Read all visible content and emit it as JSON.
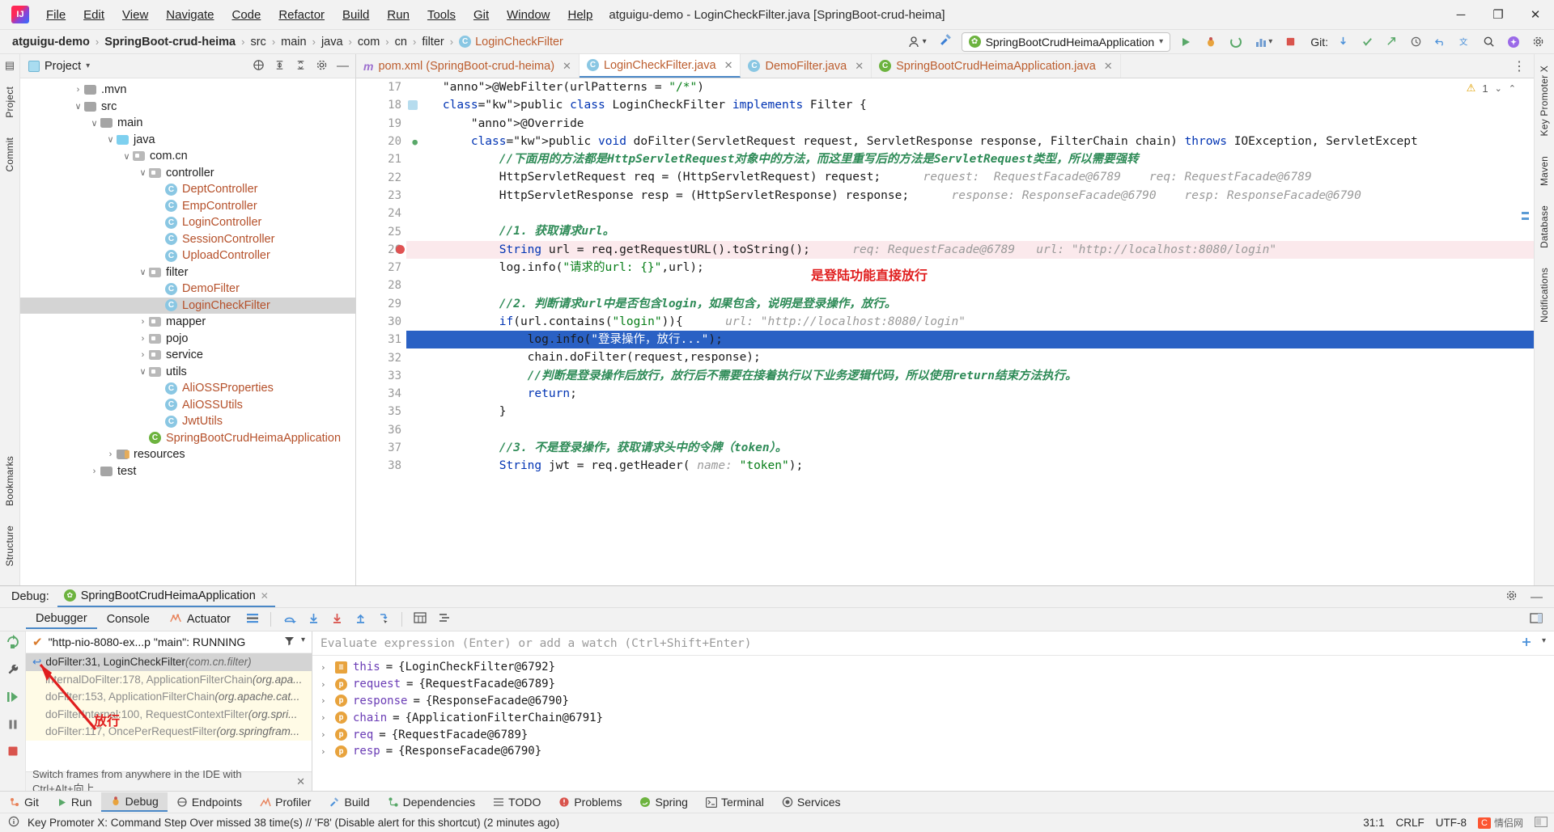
{
  "window": {
    "title": "atguigu-demo - LoginCheckFilter.java [SpringBoot-crud-heima]",
    "minimize": "─",
    "maximize": "❐",
    "close": "✕",
    "logo_text": "IJ"
  },
  "menu": [
    {
      "label": "File"
    },
    {
      "label": "Edit"
    },
    {
      "label": "View"
    },
    {
      "label": "Navigate"
    },
    {
      "label": "Code"
    },
    {
      "label": "Refactor"
    },
    {
      "label": "Build"
    },
    {
      "label": "Run"
    },
    {
      "label": "Tools"
    },
    {
      "label": "Git"
    },
    {
      "label": "Window"
    },
    {
      "label": "Help"
    }
  ],
  "breadcrumb": {
    "items": [
      {
        "label": "atguigu-demo",
        "bold": true
      },
      {
        "label": "SpringBoot-crud-heima",
        "bold": true
      },
      {
        "label": "src",
        "bold": false
      },
      {
        "label": "main",
        "bold": false
      },
      {
        "label": "java",
        "bold": false
      },
      {
        "label": "com",
        "bold": false
      },
      {
        "label": "cn",
        "bold": false
      },
      {
        "label": "filter",
        "bold": false
      },
      {
        "label": "LoginCheckFilter",
        "bold": false,
        "class_icon": "C",
        "is_file": true
      }
    ],
    "separator": "›",
    "run_config": "SpringBootCrudHeimaApplication",
    "run_config_caret": "▾",
    "git_label": "Git:"
  },
  "project_panel": {
    "title": "Project",
    "caret": "▾",
    "tree": [
      {
        "depth": 3,
        "twisty": "›",
        "icon": "folder",
        "label": ".mvn",
        "type": "dir"
      },
      {
        "depth": 3,
        "twisty": "∨",
        "icon": "folder",
        "label": "src",
        "type": "dir"
      },
      {
        "depth": 4,
        "twisty": "∨",
        "icon": "folder",
        "label": "main",
        "type": "dir"
      },
      {
        "depth": 5,
        "twisty": "∨",
        "icon": "folder-blue",
        "label": "java",
        "type": "dir"
      },
      {
        "depth": 6,
        "twisty": "∨",
        "icon": "folder-pkg",
        "label": "com.cn",
        "type": "dir"
      },
      {
        "depth": 7,
        "twisty": "∨",
        "icon": "folder-pkg",
        "label": "controller",
        "type": "dir"
      },
      {
        "depth": 8,
        "twisty": "",
        "icon": "class",
        "label": "DeptController",
        "type": "class"
      },
      {
        "depth": 8,
        "twisty": "",
        "icon": "class",
        "label": "EmpController",
        "type": "class"
      },
      {
        "depth": 8,
        "twisty": "",
        "icon": "class",
        "label": "LoginController",
        "type": "class"
      },
      {
        "depth": 8,
        "twisty": "",
        "icon": "class",
        "label": "SessionController",
        "type": "class"
      },
      {
        "depth": 8,
        "twisty": "",
        "icon": "class",
        "label": "UploadController",
        "type": "class"
      },
      {
        "depth": 7,
        "twisty": "∨",
        "icon": "folder-pkg",
        "label": "filter",
        "type": "dir"
      },
      {
        "depth": 8,
        "twisty": "",
        "icon": "class",
        "label": "DemoFilter",
        "type": "class"
      },
      {
        "depth": 8,
        "twisty": "",
        "icon": "class",
        "label": "LoginCheckFilter",
        "type": "class",
        "selected": true
      },
      {
        "depth": 7,
        "twisty": "›",
        "icon": "folder-pkg",
        "label": "mapper",
        "type": "dir"
      },
      {
        "depth": 7,
        "twisty": "›",
        "icon": "folder-pkg",
        "label": "pojo",
        "type": "dir"
      },
      {
        "depth": 7,
        "twisty": "›",
        "icon": "folder-pkg",
        "label": "service",
        "type": "dir"
      },
      {
        "depth": 7,
        "twisty": "∨",
        "icon": "folder-pkg",
        "label": "utils",
        "type": "dir"
      },
      {
        "depth": 8,
        "twisty": "",
        "icon": "class",
        "label": "AliOSSProperties",
        "type": "class"
      },
      {
        "depth": 8,
        "twisty": "",
        "icon": "class",
        "label": "AliOSSUtils",
        "type": "class"
      },
      {
        "depth": 8,
        "twisty": "",
        "icon": "class",
        "label": "JwtUtils",
        "type": "class"
      },
      {
        "depth": 7,
        "twisty": "",
        "icon": "spring",
        "label": "SpringBootCrudHeimaApplication",
        "type": "class"
      },
      {
        "depth": 5,
        "twisty": "›",
        "icon": "folder-res",
        "label": "resources",
        "type": "dir"
      },
      {
        "depth": 4,
        "twisty": "›",
        "icon": "folder",
        "label": "test",
        "type": "dir"
      }
    ]
  },
  "editor": {
    "tabs": [
      {
        "label": "pom.xml (SpringBoot-crud-heima)",
        "icon": "maven",
        "active": false
      },
      {
        "label": "LoginCheckFilter.java",
        "icon": "class",
        "active": true
      },
      {
        "label": "DemoFilter.java",
        "icon": "class",
        "active": false
      },
      {
        "label": "SpringBootCrudHeimaApplication.java",
        "icon": "spring",
        "active": false
      }
    ],
    "tab_close": "✕",
    "more": "⋮",
    "warning_count": "1",
    "warning_icon": "⚠",
    "first_line_number": 17,
    "lines": [
      {
        "n": 17,
        "fold": "−",
        "text": "    @WebFilter(urlPatterns = \"/*\")"
      },
      {
        "n": 18,
        "text": "    public class LoginCheckFilter implements Filter {"
      },
      {
        "n": 19,
        "text": "        @Override"
      },
      {
        "n": 20,
        "fold": "−",
        "text": "        public void doFilter(ServletRequest request, ServletResponse response, FilterChain chain) throws IOException, ServletExcept"
      },
      {
        "n": 21,
        "text": "            //下面用的方法都是HttpServletRequest对象中的方法，而这里重写后的方法是ServletRequest类型，所以需要强转"
      },
      {
        "n": 22,
        "text": "            HttpServletRequest req = (HttpServletRequest) request;",
        "hint": "request:  RequestFacade@6789    req: RequestFacade@6789"
      },
      {
        "n": 23,
        "text": "            HttpServletResponse resp = (HttpServletResponse) response;",
        "hint": "response: ResponseFacade@6790    resp: ResponseFacade@6790"
      },
      {
        "n": 24,
        "text": ""
      },
      {
        "n": 25,
        "text": "            //1. 获取请求url。"
      },
      {
        "n": 26,
        "text": "            String url = req.getRequestURL().toString();",
        "hint": "req: RequestFacade@6789   url: \"http://localhost:8080/login\"",
        "breakpoint": true
      },
      {
        "n": 27,
        "text": "            log.info(\"请求的url: {}\",url);"
      },
      {
        "n": 28,
        "text": ""
      },
      {
        "n": 29,
        "text": "            //2. 判断请求url中是否包含login，如果包含，说明是登录操作，放行。"
      },
      {
        "n": 30,
        "fold": "−",
        "text": "            if(url.contains(\"login\")){",
        "hint": "url: \"http://localhost:8080/login\""
      },
      {
        "n": 31,
        "text": "                log.info(\"登录操作，放行...\");",
        "highlight": true
      },
      {
        "n": 32,
        "text": "                chain.doFilter(request,response);"
      },
      {
        "n": 33,
        "text": "                //判断是登录操作后放行，放行后不需要在接着执行以下业务逻辑代码，所以使用return结束方法执行。"
      },
      {
        "n": 34,
        "text": "                return;"
      },
      {
        "n": 35,
        "fold": "−",
        "text": "            }"
      },
      {
        "n": 36,
        "text": ""
      },
      {
        "n": 37,
        "text": "            //3. 不是登录操作，获取请求头中的令牌（token）。"
      },
      {
        "n": 38,
        "text": "            String jwt = req.getHeader( name: \"token\");"
      }
    ],
    "annotation_red": "是登陆功能直接放行"
  },
  "debug": {
    "header_label": "Debug:",
    "session_tab": "SpringBootCrudHeimaApplication",
    "session_close": "✕",
    "tabs": [
      {
        "label": "Debugger",
        "active": true
      },
      {
        "label": "Console",
        "active": false
      },
      {
        "label": "Actuator",
        "active": false
      }
    ],
    "thread": "\"http-nio-8080-ex...p \"main\": RUNNING",
    "frames": [
      {
        "label": "doFilter:31, LoginCheckFilter",
        "detail": "(com.cn.filter)",
        "selected": true
      },
      {
        "label": "internalDoFilter:178, ApplicationFilterChain",
        "detail": "(org.apa...",
        "lib": true
      },
      {
        "label": "doFilter:153, ApplicationFilterChain",
        "detail": "(org.apache.cat...",
        "lib": true
      },
      {
        "label": "doFilterInternal:100, RequestContextFilter",
        "detail": "(org.spri...",
        "lib": true
      },
      {
        "label": "doFilter:117, OncePerRequestFilter",
        "detail": "(org.springfram...",
        "lib": true
      }
    ],
    "frames_footer": "Switch frames from anywhere in the IDE with Ctrl+Alt+向上.",
    "frames_footer_close": "✕",
    "evaluate_placeholder": "Evaluate expression (Enter) or add a watch (Ctrl+Shift+Enter)",
    "variables": [
      {
        "name": "this",
        "value": "{LoginCheckFilter@6792}",
        "icon": "this"
      },
      {
        "name": "request",
        "value": "{RequestFacade@6789}",
        "icon": "p"
      },
      {
        "name": "response",
        "value": "{ResponseFacade@6790}",
        "icon": "p"
      },
      {
        "name": "chain",
        "value": "{ApplicationFilterChain@6791}",
        "icon": "p"
      },
      {
        "name": "req",
        "value": "{RequestFacade@6789}",
        "icon": "p"
      },
      {
        "name": "resp",
        "value": "{ResponseFacade@6790}",
        "icon": "p"
      }
    ],
    "var_chevron": "›",
    "annotation_red": "放行"
  },
  "bottom_toolbar": [
    {
      "label": "Git",
      "icon": "git"
    },
    {
      "label": "Run",
      "icon": "run"
    },
    {
      "label": "Debug",
      "icon": "debug",
      "active": true
    },
    {
      "label": "Endpoints",
      "icon": "endpoints"
    },
    {
      "label": "Profiler",
      "icon": "profiler"
    },
    {
      "label": "Build",
      "icon": "build"
    },
    {
      "label": "Dependencies",
      "icon": "dep"
    },
    {
      "label": "TODO",
      "icon": "todo"
    },
    {
      "label": "Problems",
      "icon": "problems"
    },
    {
      "label": "Spring",
      "icon": "spring"
    },
    {
      "label": "Terminal",
      "icon": "terminal"
    },
    {
      "label": "Services",
      "icon": "services"
    }
  ],
  "statusbar": {
    "message": "Key Promoter X: Command Step Over missed 38 time(s) // 'F8' (Disable alert for this shortcut) (2 minutes ago)",
    "position": "31:1",
    "line_sep": "CRLF",
    "encoding": "UTF-8",
    "watermark": "情侣网"
  },
  "left_rail": [
    {
      "label": "Project"
    },
    {
      "label": "Commit"
    },
    {
      "label": "Bookmarks"
    },
    {
      "label": "Structure"
    }
  ],
  "right_rail": [
    {
      "label": "Key Promoter X"
    },
    {
      "label": "Maven"
    },
    {
      "label": "Database"
    },
    {
      "label": "Notifications"
    }
  ]
}
